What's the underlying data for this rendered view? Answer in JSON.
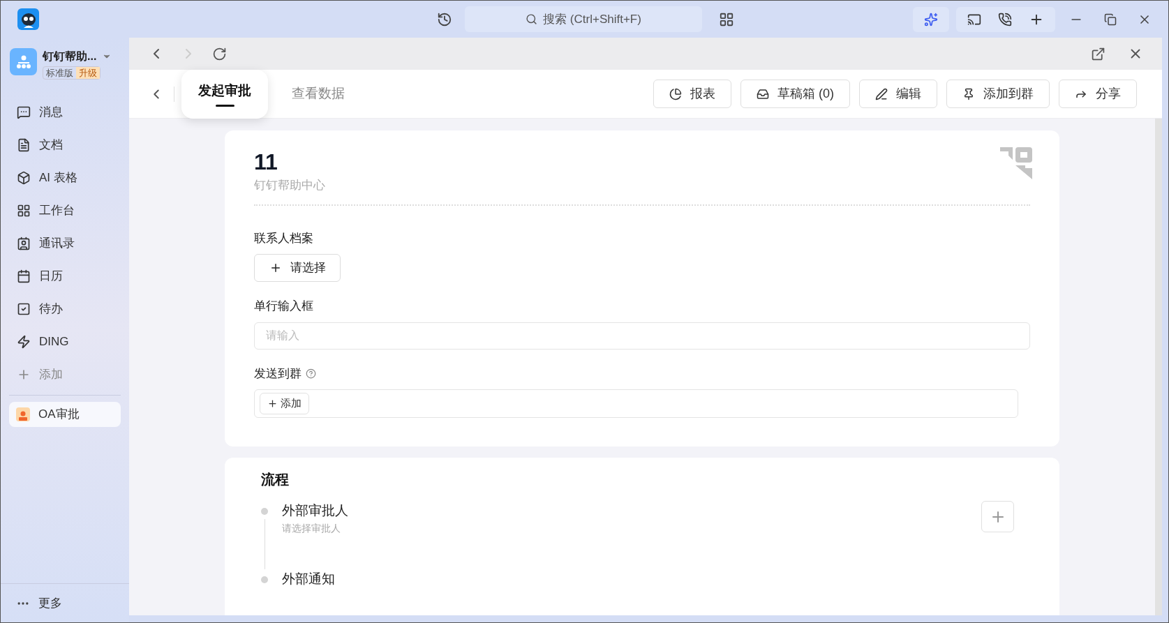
{
  "title_bar": {
    "search": {
      "placeholder": "搜索 (Ctrl+Shift+F)"
    }
  },
  "org": {
    "name": "钉钉帮助...",
    "edition": "标准版",
    "upgrade": "升级"
  },
  "sidebar": {
    "items": [
      {
        "kind": "message",
        "label": "消息",
        "selected": false
      },
      {
        "kind": "docs",
        "label": "文档",
        "selected": false
      },
      {
        "kind": "table",
        "label": "AI 表格",
        "selected": false
      },
      {
        "kind": "workbench",
        "label": "工作台",
        "selected": false
      },
      {
        "kind": "contacts",
        "label": "通讯录",
        "selected": false
      },
      {
        "kind": "calendar",
        "label": "日历",
        "selected": false
      },
      {
        "kind": "todo",
        "label": "待办",
        "selected": false
      },
      {
        "kind": "ding",
        "label": "DING",
        "selected": false
      },
      {
        "kind": "add",
        "label": "添加",
        "selected": false
      }
    ],
    "apps": [
      {
        "label": "OA审批",
        "selected": true
      }
    ],
    "more": "更多"
  },
  "tabs": [
    {
      "label": "发起审批",
      "selected": true
    },
    {
      "label": "查看数据",
      "selected": false
    }
  ],
  "actions": [
    {
      "kind": "report",
      "label": "报表"
    },
    {
      "kind": "drafts",
      "label": "草稿箱 (0)"
    },
    {
      "kind": "edit",
      "label": "编辑"
    },
    {
      "kind": "pin",
      "label": "添加到群"
    },
    {
      "kind": "share",
      "label": "分享"
    }
  ],
  "form": {
    "title": "11",
    "subtitle": "钉钉帮助中心",
    "fields": [
      {
        "kind": "picker",
        "label": "联系人档案",
        "button": "请选择"
      },
      {
        "kind": "text",
        "label": "单行输入框",
        "placeholder": "请输入"
      },
      {
        "kind": "group",
        "label": "发送到群",
        "button": "添加"
      }
    ]
  },
  "flow": {
    "title": "流程",
    "steps": [
      {
        "title": "外部审批人",
        "subtitle": "请选择审批人"
      },
      {
        "title": "外部通知"
      }
    ]
  }
}
